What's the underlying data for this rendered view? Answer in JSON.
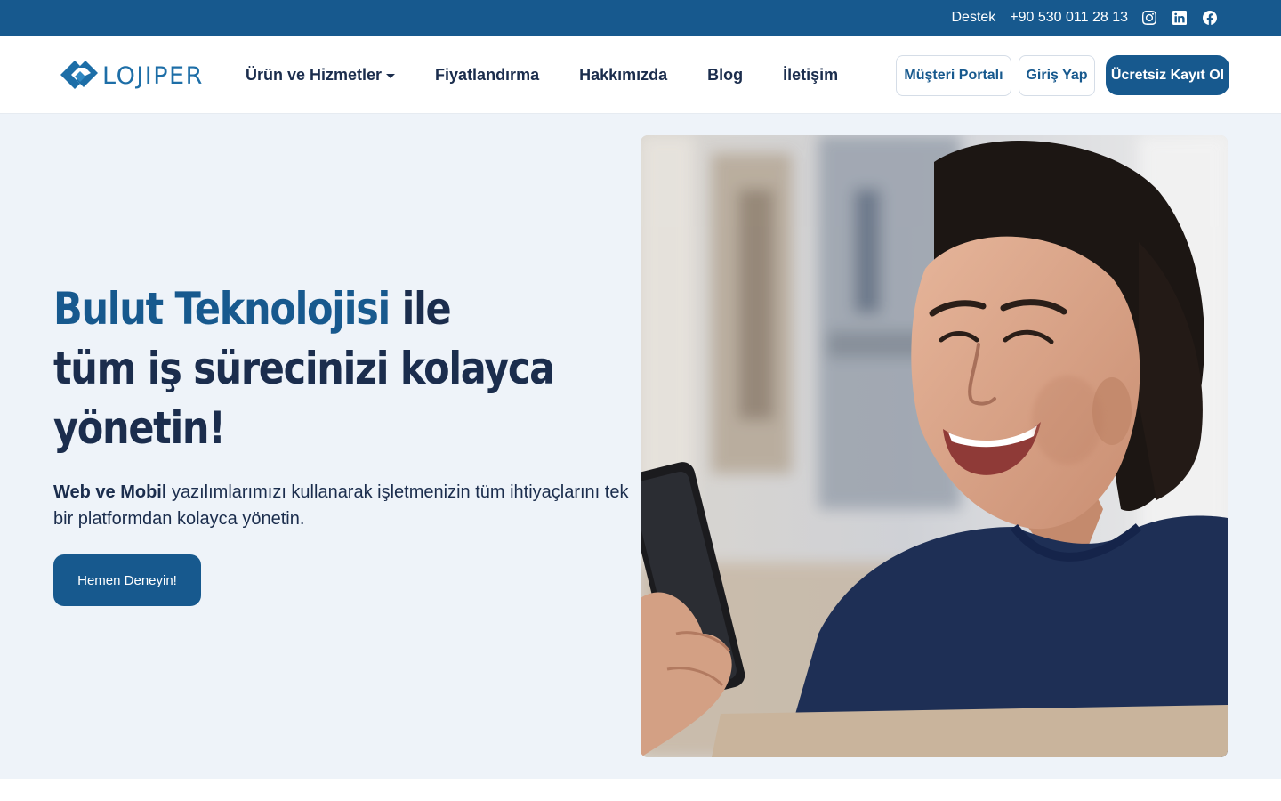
{
  "topbar": {
    "support_label": "Destek",
    "phone": "+90 530 011 28 13",
    "social": [
      {
        "icon": "instagram-icon"
      },
      {
        "icon": "linkedin-icon"
      },
      {
        "icon": "facebook-icon"
      }
    ]
  },
  "brand": {
    "name": "LOJIPER",
    "logo_icon": "lojiper-logo-mark"
  },
  "nav": {
    "items": [
      {
        "label": "Ürün ve Hizmetler",
        "has_dropdown": true
      },
      {
        "label": "Fiyatlandırma"
      },
      {
        "label": "Hakkımızda"
      },
      {
        "label": "Blog"
      },
      {
        "label": "İletişim"
      }
    ]
  },
  "header_actions": {
    "customer_portal": "Müşteri Portalı",
    "login": "Giriş Yap",
    "signup": "Ücretsiz Kayıt Ol"
  },
  "hero": {
    "title_accent": "Bulut Teknolojisi",
    "title_rest_1": " ile",
    "title_line_2": "tüm iş sürecinizi kolayca",
    "title_line_3": "yönetin!",
    "subtitle_bold": "Web ve Mobil",
    "subtitle_rest": " yazılımlarımızı kullanarak işletmenizin tüm ihtiyaçlarını tek bir platformdan kolayca yönetin.",
    "cta_label": "Hemen Deneyin!",
    "image_alt": "smiling-woman-with-phone"
  },
  "colors": {
    "primary": "#17598e",
    "heading": "#1b2d4d",
    "hero_bg": "#eef3f9",
    "topbar_bg": "#17598e"
  }
}
